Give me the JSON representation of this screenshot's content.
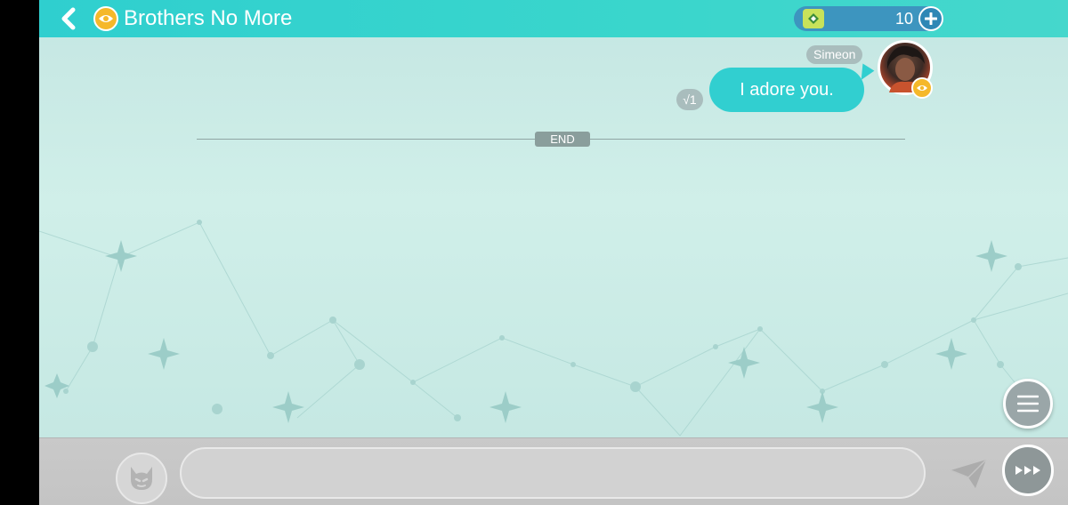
{
  "header": {
    "back_icon": "chevron-left-icon",
    "badge_icon": "eye-icon",
    "title": "Brothers No More",
    "currency": {
      "icon": "gem-icon",
      "value": "10",
      "add_icon": "plus-icon"
    }
  },
  "chat": {
    "messages": [
      {
        "sender": "Simeon",
        "text": "I adore you.",
        "read_receipt": "√1",
        "avatar_badge_icon": "eye-icon"
      }
    ],
    "end_label": "END"
  },
  "controls": {
    "menu_icon": "hamburger-icon",
    "stamp_icon": "devil-face-icon",
    "input_value": "",
    "send_icon": "paper-plane-icon",
    "skip_icon": "fast-forward-icon"
  },
  "colors": {
    "header": "#3ad6cc",
    "bubble": "#31cfd0",
    "background": "#c9ebe6",
    "input_bar": "#c6c6c6"
  }
}
